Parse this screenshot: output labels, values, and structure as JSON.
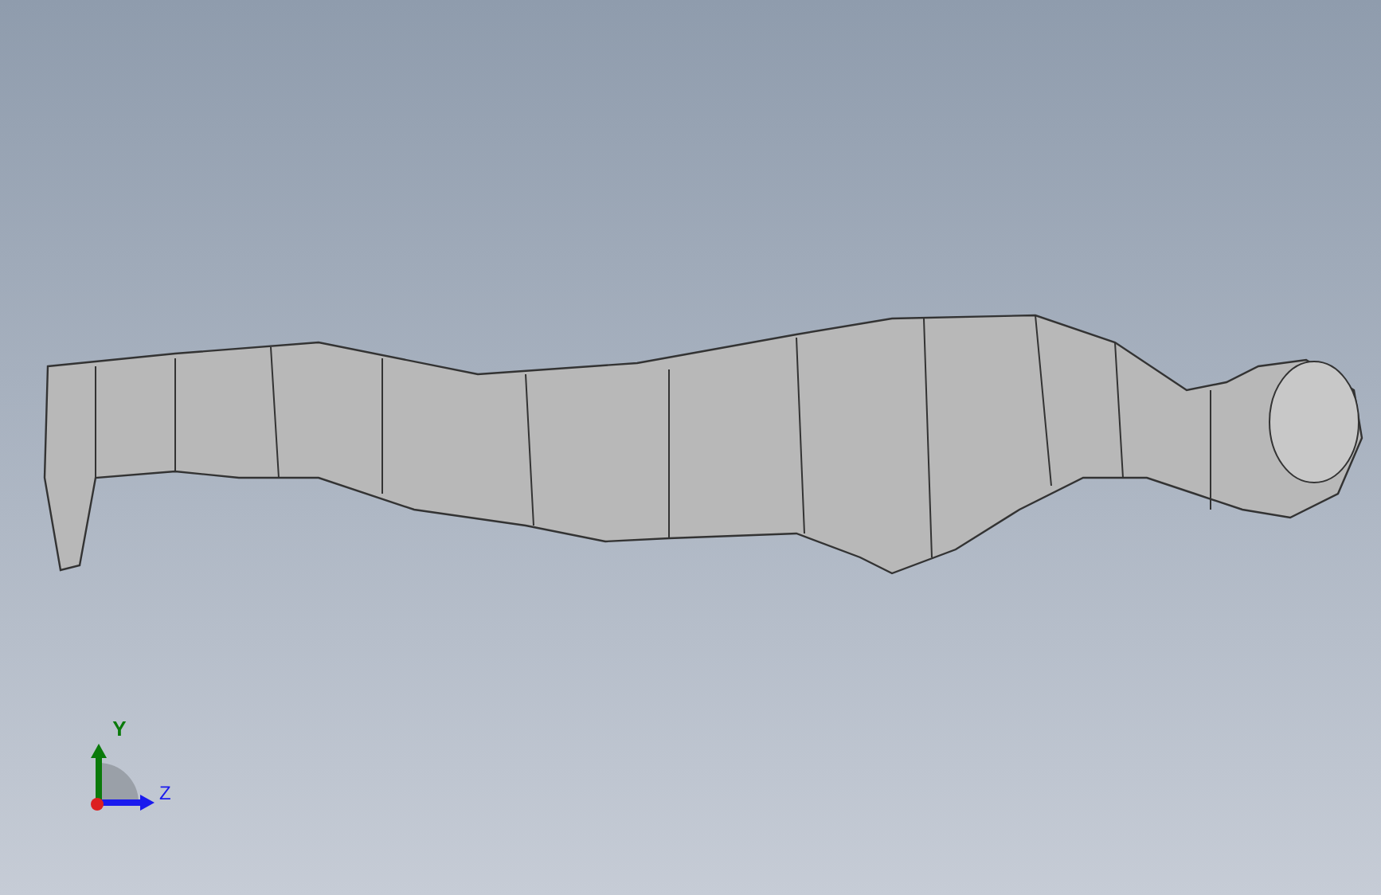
{
  "triad": {
    "axes": [
      {
        "label": "Y",
        "color": "#0a7a0a"
      },
      {
        "label": "Z",
        "color": "#1a1aee"
      }
    ]
  }
}
